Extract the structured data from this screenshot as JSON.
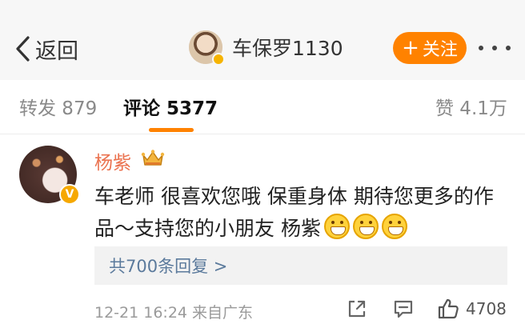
{
  "nav": {
    "back_label": "返回",
    "user_name": "车保罗1130",
    "follow_label": "关注"
  },
  "tabs": {
    "repost": "转发 879",
    "comments": "评论 5377",
    "likes": "赞 4.1万"
  },
  "comment": {
    "author": "杨紫",
    "verified_badge": "V",
    "text": "车老师 很喜欢您哦 保重身体 期待您更多的作品～支持您的小朋友 杨紫",
    "emojis": [
      "grin-emoji",
      "grin-emoji",
      "grin-emoji"
    ],
    "replies_link": "共700条回复 >",
    "timestamp_source": "12-21 16:24 来自广东",
    "like_count": "4708"
  },
  "colors": {
    "accent_orange": "#ff8200",
    "author_name": "#eb7350",
    "reply_link": "#5b7a9c"
  }
}
